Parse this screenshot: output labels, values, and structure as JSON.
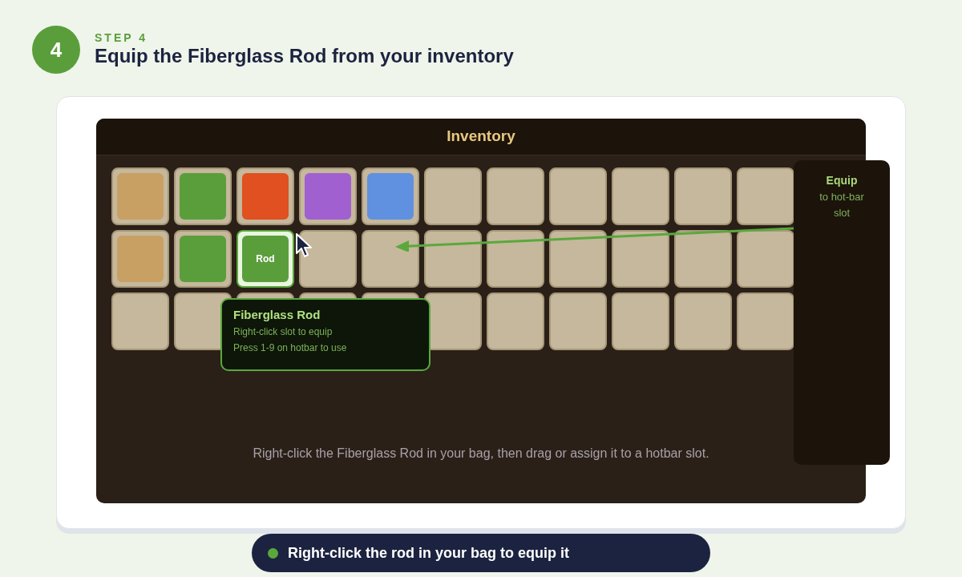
{
  "step": {
    "number": "4",
    "label": "STEP 4",
    "title": "Equip the Fiberglass Rod from your inventory"
  },
  "inventory": {
    "title": "Inventory",
    "slots": [
      {
        "kind": "item",
        "color": "#c9a063",
        "selected": false
      },
      {
        "kind": "item",
        "color": "#5a9e3c",
        "selected": false
      },
      {
        "kind": "item",
        "color": "#e05020",
        "selected": false
      },
      {
        "kind": "item",
        "color": "#a060d0",
        "selected": false
      },
      {
        "kind": "item",
        "color": "#6090e0",
        "selected": false
      },
      {
        "kind": "empty",
        "selected": false
      },
      {
        "kind": "empty",
        "selected": false
      },
      {
        "kind": "empty",
        "selected": false
      },
      {
        "kind": "empty",
        "selected": false
      },
      {
        "kind": "empty",
        "selected": false
      },
      {
        "kind": "empty",
        "selected": false
      },
      {
        "kind": "item",
        "color": "#c9a063",
        "selected": false
      },
      {
        "kind": "item",
        "color": "#5a9e3c",
        "selected": false
      },
      {
        "kind": "item",
        "color": "#5a9e3c",
        "selected": true,
        "label": "Rod"
      },
      {
        "kind": "empty",
        "selected": false
      },
      {
        "kind": "empty",
        "selected": false
      },
      {
        "kind": "empty",
        "selected": false
      },
      {
        "kind": "empty",
        "selected": false
      },
      {
        "kind": "empty",
        "selected": false
      },
      {
        "kind": "empty",
        "selected": false
      },
      {
        "kind": "empty",
        "selected": false
      },
      {
        "kind": "empty",
        "selected": false
      },
      {
        "kind": "empty",
        "selected": false
      },
      {
        "kind": "empty",
        "selected": false
      },
      {
        "kind": "empty",
        "selected": false
      },
      {
        "kind": "empty",
        "selected": false
      },
      {
        "kind": "empty",
        "selected": false
      },
      {
        "kind": "empty",
        "selected": false
      },
      {
        "kind": "empty",
        "selected": false
      },
      {
        "kind": "empty",
        "selected": false
      },
      {
        "kind": "empty",
        "selected": false
      },
      {
        "kind": "empty",
        "selected": false
      },
      {
        "kind": "empty",
        "selected": false
      }
    ],
    "tooltip": {
      "title": "Fiberglass Rod",
      "lines": [
        "Right-click slot to equip",
        "Press 1-9 on hotbar to use"
      ]
    },
    "hint": "Right-click the Fiberglass Rod in your bag, then drag or assign it to a hotbar slot."
  },
  "side_panel": {
    "title": "Equip",
    "text": "to hot-bar slot"
  },
  "caption": "Right-click the rod in your bag to equip it"
}
